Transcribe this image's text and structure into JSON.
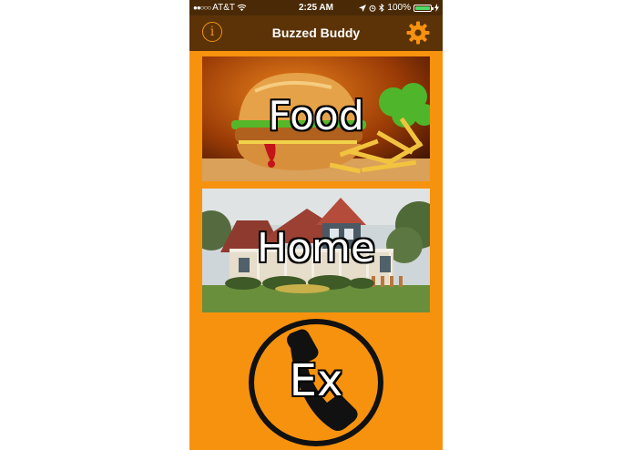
{
  "status_bar": {
    "signal": "●●○○○",
    "carrier": "AT&T",
    "time": "2:25 AM",
    "battery_percent": "100%",
    "battery_level": 1.0
  },
  "nav": {
    "title": "Buzzed Buddy",
    "info_glyph": "i",
    "info_icon": "info-circle-icon",
    "settings_icon": "gear-icon"
  },
  "tiles": {
    "food_label": "Food",
    "home_label": "Home"
  },
  "ex_button": {
    "label": "Ex",
    "icon": "phone-handset-icon"
  },
  "colors": {
    "background": "#f7920e",
    "navbar": "#5b3307",
    "accent": "#f7920e"
  }
}
